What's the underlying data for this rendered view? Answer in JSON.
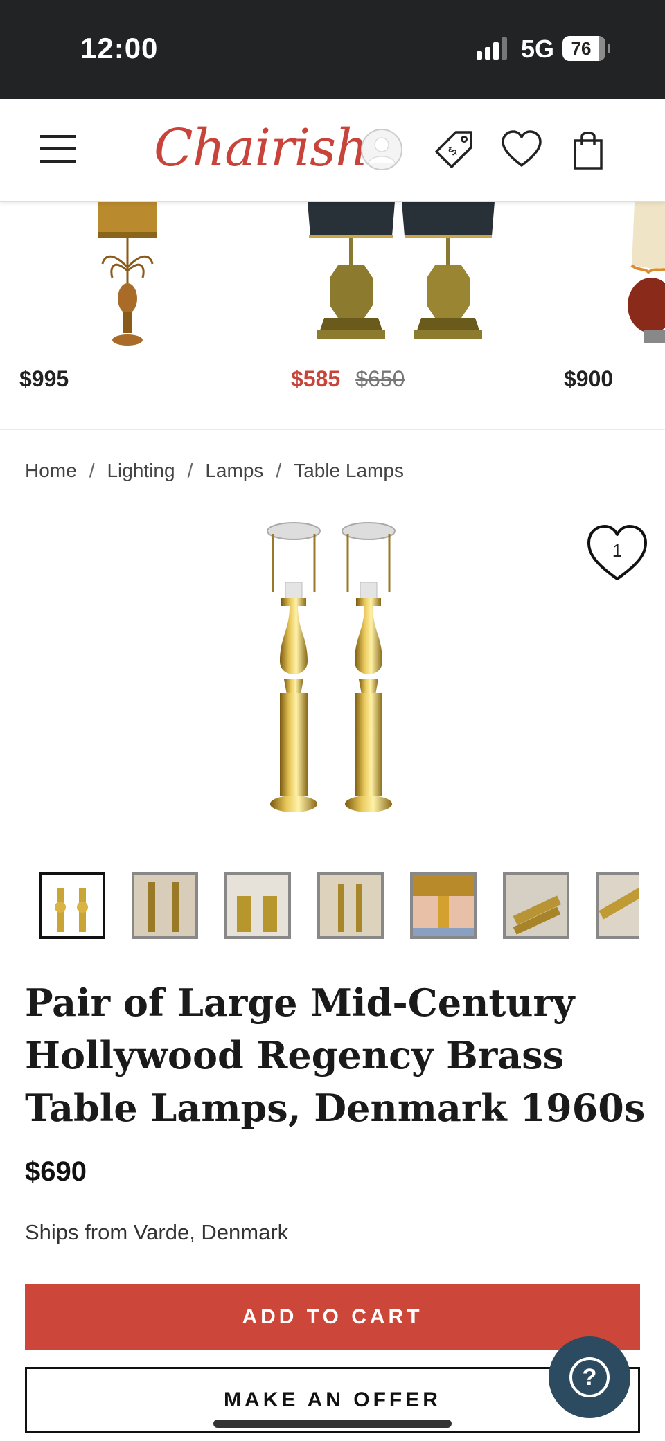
{
  "status_bar": {
    "time": "12:00",
    "network": "5G",
    "battery": "76"
  },
  "header": {
    "logo": "Chairish",
    "icons": [
      "menu-icon",
      "profile-icon",
      "price-tag-icon",
      "heart-icon",
      "shopping-bag-icon"
    ]
  },
  "carousel": {
    "items": [
      {
        "price": "$995"
      },
      {
        "price": "$585",
        "original_price": "$650"
      },
      {
        "price": "$900"
      }
    ]
  },
  "breadcrumb": {
    "items": [
      "Home",
      "Lighting",
      "Lamps",
      "Table Lamps"
    ],
    "separator": "/"
  },
  "product": {
    "favorite_count": "1",
    "title": "Pair of Large Mid-Century Hollywood Regency Brass Table Lamps, Denmark 1960s",
    "price": "$690",
    "ships_from": "Ships from Varde, Denmark",
    "thumbnail_count": 7
  },
  "actions": {
    "add_to_cart": "ADD TO CART",
    "make_offer": "MAKE AN OFFER",
    "help": "?"
  },
  "colors": {
    "brand": "#c8443a",
    "cart_button": "#cd463a",
    "help_button": "#2c4a60",
    "status_bar": "#222325"
  }
}
